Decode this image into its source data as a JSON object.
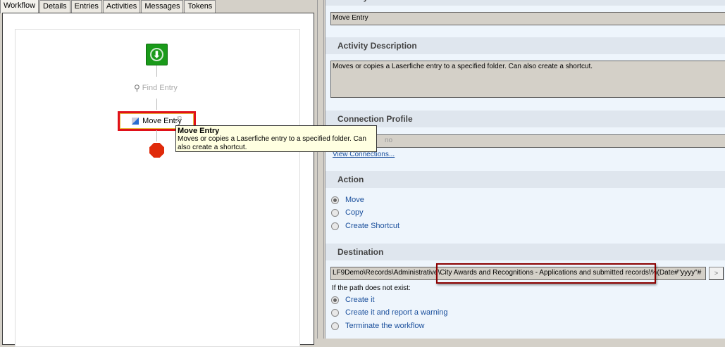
{
  "tabs": [
    "Workflow",
    "Details",
    "Entries",
    "Activities",
    "Messages",
    "Tokens"
  ],
  "workflow": {
    "find_entry": "Find Entry",
    "move_entry": "Move Entry"
  },
  "tooltip": {
    "title": "Move Entry",
    "text": "Moves or copies a Laserfiche entry to a specified folder. Can also create a shortcut."
  },
  "properties": {
    "activity_name_header": "Activity Name",
    "activity_name": "Move Entry",
    "activity_description_header": "Activity Description",
    "activity_description": "Moves or copies a Laserfiche entry to a specified folder.  Can also create a shortcut.",
    "connection_profile_header": "Connection Profile",
    "connection_profile_visible": "no",
    "view_connections": "View Connections...",
    "action_header": "Action",
    "actions": [
      {
        "label": "Move",
        "selected": true
      },
      {
        "label": "Copy",
        "selected": false
      },
      {
        "label": "Create Shortcut",
        "selected": false
      }
    ],
    "destination_header": "Destination",
    "destination_path": "LF9Demo\\Records\\Administrative\\City Awards and Recognitions -  Applications and submitted records\\%(Date#\"yyyy\"#",
    "browse_button": ">",
    "path_missing_label": "If the path does not exist:",
    "path_options": [
      {
        "label": "Create it",
        "selected": true
      },
      {
        "label": "Create it and report a warning",
        "selected": false
      },
      {
        "label": "Terminate the workflow",
        "selected": false
      }
    ]
  },
  "colors": {
    "highlight": "#e0101a",
    "annotation": "#8b0000",
    "link": "#1a4f9c"
  }
}
